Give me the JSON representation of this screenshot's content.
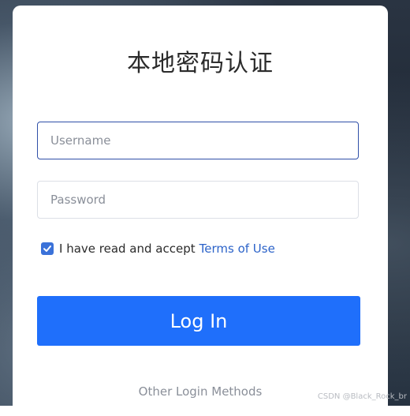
{
  "auth": {
    "title": "本地密码认证",
    "username_placeholder": "Username",
    "username_value": "",
    "password_placeholder": "Password",
    "password_value": "",
    "agree_text": "I have read and accept",
    "terms_label": "Terms of Use",
    "agree_checked": true,
    "login_label": "Log In",
    "other_methods_label": "Other Login Methods"
  },
  "watermark": "CSDN @Black_Rock_br",
  "colors": {
    "primary_button": "#1f6ffb",
    "link": "#2c63c9",
    "checkbox": "#3b72d9",
    "focused_border": "#2f4fa8"
  }
}
